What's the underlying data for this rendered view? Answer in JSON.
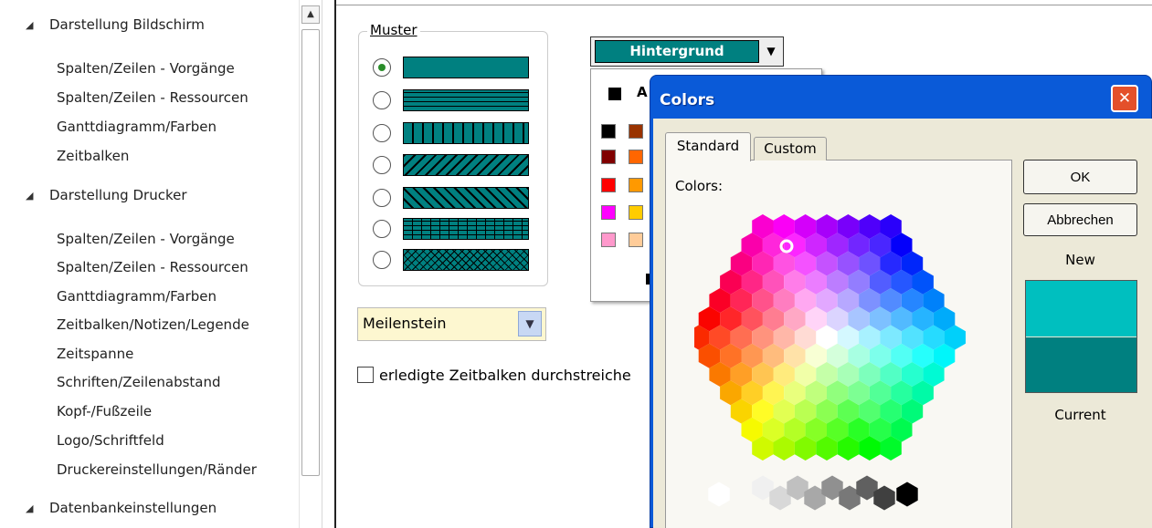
{
  "sidebar": {
    "groups": [
      {
        "label": "Darstellung Bildschirm",
        "items": [
          "Spalten/Zeilen - Vorgänge",
          "Spalten/Zeilen - Ressourcen",
          "Ganttdiagramm/Farben",
          "Zeitbalken"
        ]
      },
      {
        "label": "Darstellung Drucker",
        "items": [
          "Spalten/Zeilen - Vorgänge",
          "Spalten/Zeilen - Ressourcen",
          "Ganttdiagramm/Farben",
          "Zeitbalken/Notizen/Legende",
          "Zeitspanne",
          "Schriften/Zeilenabstand",
          "Kopf-/Fußzeile",
          "Logo/Schriftfeld",
          "Druckereinstellungen/Ränder"
        ]
      },
      {
        "label": "Datenbankeinstellungen",
        "items": []
      }
    ]
  },
  "muster": {
    "title": "Muster",
    "selected_index": 0
  },
  "hintergrund": {
    "label": "Hintergrund",
    "popup_auto_text": "A"
  },
  "select": {
    "value": "Meilenstein"
  },
  "checkbox": {
    "label": "erledigte Zeitbalken durchstreiche",
    "checked": false
  },
  "dialog": {
    "title": "Colors",
    "tabs": [
      "Standard",
      "Custom"
    ],
    "active_tab": "Standard",
    "colors_label": "Colors:",
    "ok": "OK",
    "cancel": "Abbrechen",
    "new_label": "New",
    "current_label": "Current",
    "new_color": "#00bfbf",
    "current_color": "#008080"
  },
  "colors": {
    "accent": "#008080",
    "dialog_title_bar": "#0a5ad8"
  }
}
